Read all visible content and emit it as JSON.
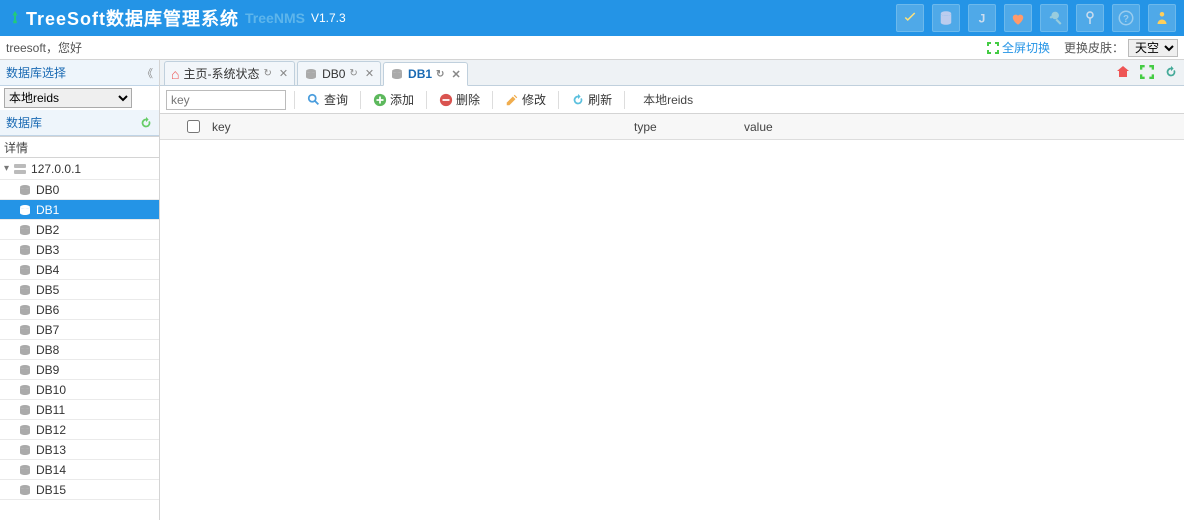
{
  "header": {
    "title": "TreeSoft数据库管理系统",
    "subtitle": "TreeNMS",
    "version": "V1.7.3"
  },
  "userbar": {
    "greeting": "treesoft，您好",
    "fullscreen": "全屏切换",
    "skin_label": "更换皮肤：",
    "skin_value": "天空蓝"
  },
  "sidebar": {
    "select_title": "数据库选择",
    "collapse_glyph": "《",
    "selected_source": "本地reids",
    "db_title": "数据库",
    "detail_title": "详情",
    "root": "127.0.0.1",
    "items": [
      {
        "label": "DB0",
        "selected": false
      },
      {
        "label": "DB1",
        "selected": true
      },
      {
        "label": "DB2",
        "selected": false
      },
      {
        "label": "DB3",
        "selected": false
      },
      {
        "label": "DB4",
        "selected": false
      },
      {
        "label": "DB5",
        "selected": false
      },
      {
        "label": "DB6",
        "selected": false
      },
      {
        "label": "DB7",
        "selected": false
      },
      {
        "label": "DB8",
        "selected": false
      },
      {
        "label": "DB9",
        "selected": false
      },
      {
        "label": "DB10",
        "selected": false
      },
      {
        "label": "DB11",
        "selected": false
      },
      {
        "label": "DB12",
        "selected": false
      },
      {
        "label": "DB13",
        "selected": false
      },
      {
        "label": "DB14",
        "selected": false
      },
      {
        "label": "DB15",
        "selected": false
      }
    ]
  },
  "tabs": {
    "items": [
      {
        "label": "主页-系统状态",
        "type": "home",
        "active": false,
        "closable": true
      },
      {
        "label": "DB0",
        "type": "db",
        "active": false,
        "closable": true
      },
      {
        "label": "DB1",
        "type": "db",
        "active": true,
        "closable": true
      }
    ]
  },
  "toolbar": {
    "key_placeholder": "key",
    "search": "查询",
    "add": "添加",
    "delete": "删除",
    "edit": "修改",
    "refresh": "刷新",
    "source": "本地reids"
  },
  "table": {
    "col_key": "key",
    "col_type": "type",
    "col_value": "value"
  }
}
